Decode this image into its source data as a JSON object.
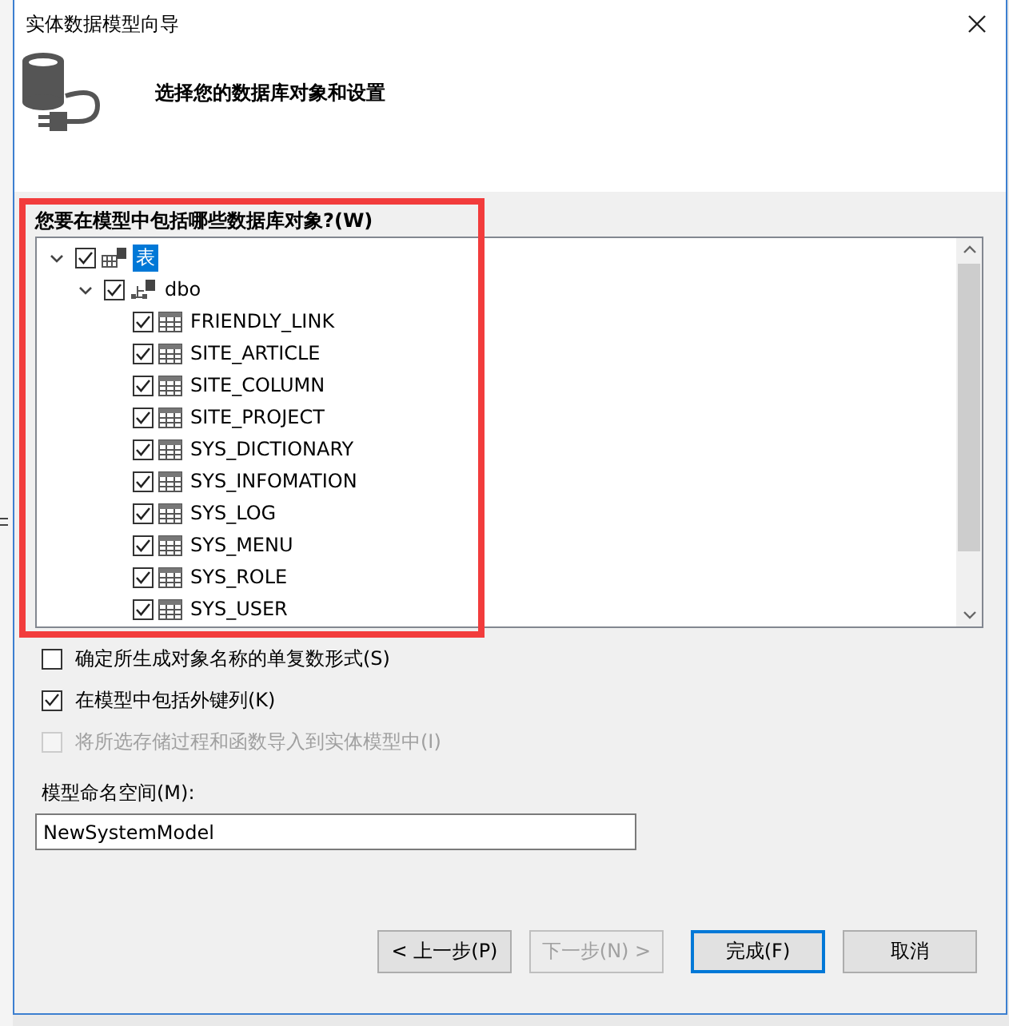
{
  "window": {
    "title": "实体数据模型向导"
  },
  "header": {
    "heading": "选择您的数据库对象和设置"
  },
  "objects": {
    "label": "您要在模型中包括哪些数据库对象?(W)",
    "highlighted": true,
    "tree": [
      {
        "label": "表",
        "kind": "folder",
        "checked": true,
        "expanded": true,
        "selected": true,
        "children": [
          {
            "label": "dbo",
            "kind": "schema",
            "checked": true,
            "expanded": true,
            "selected": false,
            "children": [
              {
                "label": "FRIENDLY_LINK",
                "kind": "table",
                "checked": true,
                "selected": false
              },
              {
                "label": "SITE_ARTICLE",
                "kind": "table",
                "checked": true,
                "selected": false
              },
              {
                "label": "SITE_COLUMN",
                "kind": "table",
                "checked": true,
                "selected": false
              },
              {
                "label": "SITE_PROJECT",
                "kind": "table",
                "checked": true,
                "selected": false
              },
              {
                "label": "SYS_DICTIONARY",
                "kind": "table",
                "checked": true,
                "selected": false
              },
              {
                "label": "SYS_INFOMATION",
                "kind": "table",
                "checked": true,
                "selected": false
              },
              {
                "label": "SYS_LOG",
                "kind": "table",
                "checked": true,
                "selected": false
              },
              {
                "label": "SYS_MENU",
                "kind": "table",
                "checked": true,
                "selected": false
              },
              {
                "label": "SYS_ROLE",
                "kind": "table",
                "checked": true,
                "selected": false
              },
              {
                "label": "SYS_USER",
                "kind": "table",
                "checked": true,
                "selected": false
              }
            ]
          }
        ]
      }
    ]
  },
  "options": [
    {
      "label": "确定所生成对象名称的单复数形式(S)",
      "checked": false,
      "disabled": false
    },
    {
      "label": "在模型中包括外键列(K)",
      "checked": true,
      "disabled": false
    },
    {
      "label": "将所选存储过程和函数导入到实体模型中(I)",
      "checked": false,
      "disabled": true
    }
  ],
  "namespace": {
    "label": "模型命名空间(M):",
    "value": "NewSystemModel"
  },
  "buttons": [
    {
      "label": "< 上一步(P)",
      "disabled": false,
      "default": false
    },
    {
      "label": "下一步(N) >",
      "disabled": true,
      "default": false
    },
    {
      "label": "完成(F)",
      "disabled": false,
      "default": true
    },
    {
      "label": "取消",
      "disabled": false,
      "default": false
    }
  ]
}
